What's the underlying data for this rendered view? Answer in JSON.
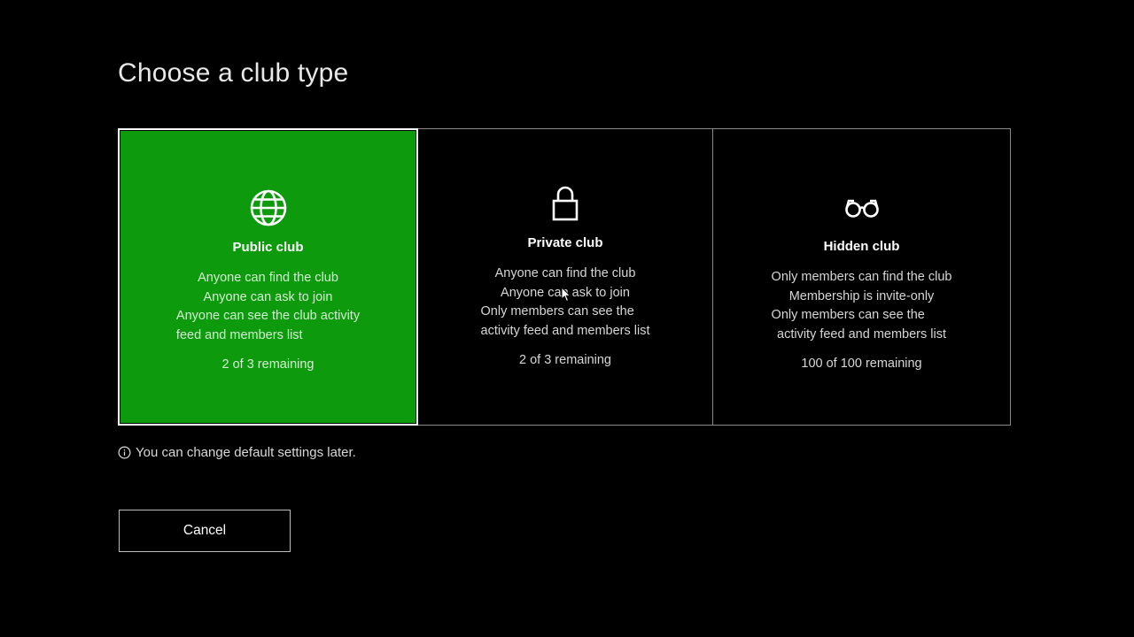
{
  "page": {
    "title": "Choose a club type",
    "info_text": "You can change default settings later.",
    "cancel_label": "Cancel"
  },
  "colors": {
    "selected_card": "#0d9a0d",
    "background": "#000000",
    "border": "#8a8a8a"
  },
  "cards": [
    {
      "icon": "globe-icon",
      "title": "Public club",
      "selected": true,
      "lines": [
        "Anyone can find the club",
        "Anyone can ask to join",
        "Anyone can see the club activity",
        "feed and members list"
      ],
      "remaining": "2 of 3 remaining"
    },
    {
      "icon": "lock-icon",
      "title": "Private club",
      "selected": false,
      "lines": [
        "Anyone can find the club",
        "Anyone can ask to join",
        "Only members can see the",
        "activity feed and members list"
      ],
      "remaining": "2 of 3 remaining"
    },
    {
      "icon": "glasses-icon",
      "title": "Hidden club",
      "selected": false,
      "lines": [
        "Only members can find the club",
        "Membership is invite-only",
        "Only members can see the",
        "activity feed and members list"
      ],
      "remaining": "100 of 100 remaining"
    }
  ]
}
